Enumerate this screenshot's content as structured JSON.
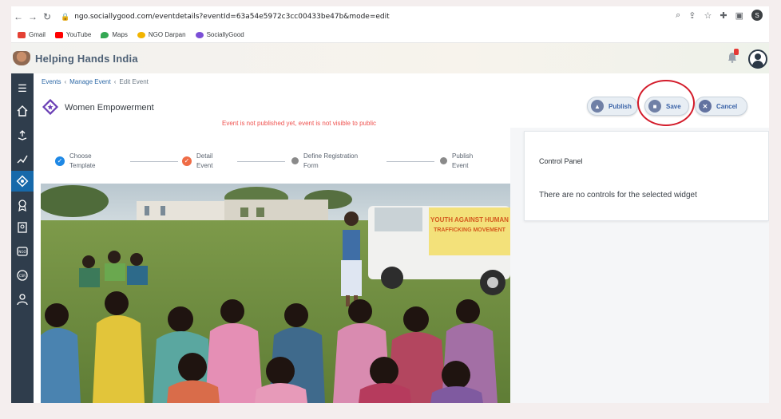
{
  "browser": {
    "url": "ngo.sociallygood.com/eventdetails?eventId=63a54e5972c3cc00433be47b&mode=edit",
    "profile_initial": "S",
    "bookmarks": [
      "Gmail",
      "YouTube",
      "Maps",
      "NGO Darpan",
      "SociallyGood"
    ]
  },
  "app": {
    "title": "Helping Hands India",
    "notification_count": "0"
  },
  "breadcrumb": {
    "items": [
      "Events",
      "Manage Event",
      "Edit Event"
    ]
  },
  "event": {
    "title": "Women Empowerment",
    "warning": "Event is not published yet, event is not visible to public"
  },
  "actions": {
    "publish_label": "Publish",
    "save_label": "Save",
    "cancel_label": "Cancel"
  },
  "steps": [
    {
      "label": "Choose\nTemplate",
      "state": "done"
    },
    {
      "label": "Detail\nEvent",
      "state": "current"
    },
    {
      "label": "Define Registration\nForm",
      "state": "pending"
    },
    {
      "label": "Publish\nEvent",
      "state": "pending"
    }
  ],
  "photo": {
    "banner_line1": "YOUTH AGAINST HUMAN",
    "banner_line2": "TRAFFICKING MOVEMENT"
  },
  "control_panel": {
    "title": "Control Panel",
    "message": "There are no controls for the selected widget"
  },
  "colors": {
    "sidebar": "#2f3d4c",
    "sidebar_active": "#1769aa",
    "brand_text": "#4d6075",
    "warning": "#ef5350",
    "annotation": "#d31b2a"
  }
}
